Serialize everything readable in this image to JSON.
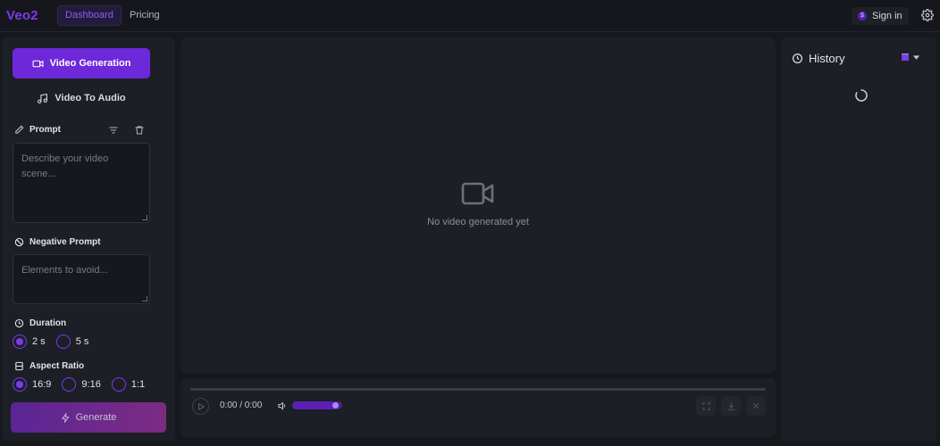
{
  "header": {
    "logo": "Veo2",
    "tabs": [
      {
        "label": "Dashboard",
        "active": true
      },
      {
        "label": "Pricing",
        "active": false
      }
    ],
    "signin_label": "Sign in",
    "accent_color": "#7c3aed"
  },
  "left_panel": {
    "mode_tabs": [
      {
        "label": "Video Generation",
        "active": true,
        "icon": "video-icon"
      },
      {
        "label": "Video To Audio",
        "active": false,
        "icon": "music-icon"
      }
    ],
    "prompt": {
      "label": "Prompt",
      "placeholder": "Describe your video scene...",
      "value": ""
    },
    "negative_prompt": {
      "label": "Negative Prompt",
      "placeholder": "Elements to avoid...",
      "value": ""
    },
    "duration": {
      "label": "Duration",
      "options": [
        "2 s",
        "5 s"
      ],
      "selected": "2 s"
    },
    "aspect_ratio": {
      "label": "Aspect Ratio",
      "options": [
        "16:9",
        "9:16",
        "1:1"
      ],
      "selected": "16:9"
    },
    "generate_label": "Generate"
  },
  "preview": {
    "empty_text": "No video generated yet"
  },
  "player": {
    "time": "0:00 / 0:00",
    "volume_fraction": 0.85
  },
  "history": {
    "title": "History",
    "loading": true
  }
}
